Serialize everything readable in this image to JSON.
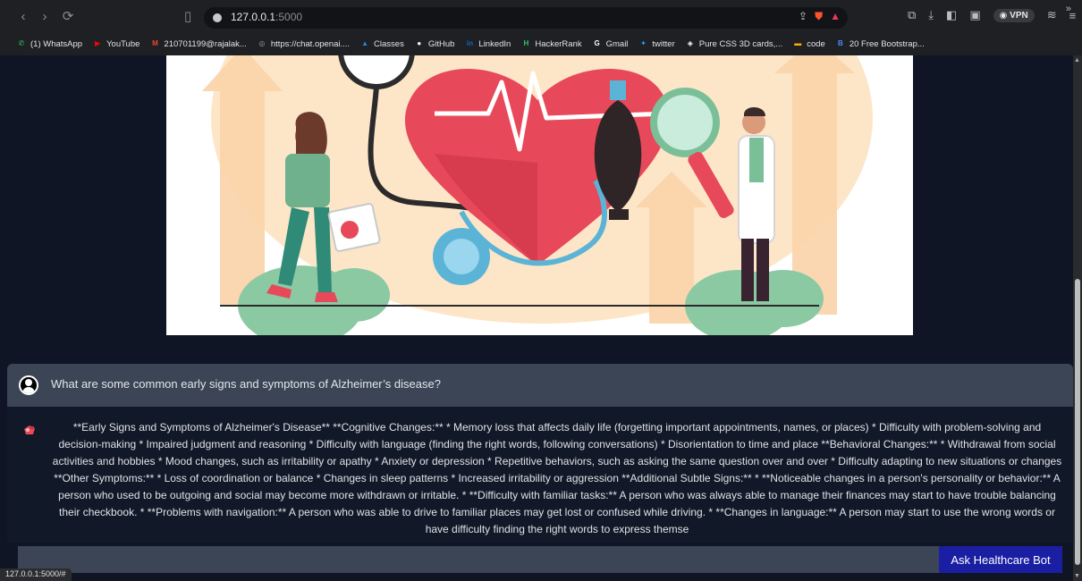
{
  "browser": {
    "url_host": "127.0.0.1",
    "url_port": ":5000",
    "vpn_label": "VPN",
    "bookmarks": [
      {
        "label": "(1) WhatsApp",
        "icon": "whatsapp-icon",
        "color": "#25d366"
      },
      {
        "label": "YouTube",
        "icon": "youtube-icon",
        "color": "#ff0000"
      },
      {
        "label": "210701199@rajalak...",
        "icon": "gmail-icon",
        "color": "#ea4335"
      },
      {
        "label": "https://chat.openai....",
        "icon": "openai-icon",
        "color": "#9a9a9a"
      },
      {
        "label": "Classes",
        "icon": "classroom-icon",
        "color": "#1e88e5"
      },
      {
        "label": "GitHub",
        "icon": "github-icon",
        "color": "#ffffff"
      },
      {
        "label": "LinkedIn",
        "icon": "linkedin-icon",
        "color": "#0a66c2"
      },
      {
        "label": "HackerRank",
        "icon": "hackerrank-icon",
        "color": "#2ec866"
      },
      {
        "label": "Gmail",
        "icon": "google-icon",
        "color": "#ffffff"
      },
      {
        "label": "twitter",
        "icon": "twitter-icon",
        "color": "#1da1f2"
      },
      {
        "label": "Pure CSS 3D cards,...",
        "icon": "codepen-icon",
        "color": "#ffffff"
      },
      {
        "label": "code",
        "icon": "folder-icon",
        "color": "#f4b400"
      },
      {
        "label": "20 Free Bootstrap...",
        "icon": "bootstrap-icon",
        "color": "#4a8cf7"
      }
    ],
    "bookmarks_more": "»",
    "status_url": "127.0.0.1:5000/#"
  },
  "chat": {
    "question": "What are some common early signs and symptoms of Alzheimer’s disease?",
    "answer": "**Early Signs and Symptoms of Alzheimer's Disease** **Cognitive Changes:** * Memory loss that affects daily life (forgetting important appointments, names, or places) * Difficulty with problem-solving and decision-making * Impaired judgment and reasoning * Difficulty with language (finding the right words, following conversations) * Disorientation to time and place **Behavioral Changes:** * Withdrawal from social activities and hobbies * Mood changes, such as irritability or apathy * Anxiety or depression * Repetitive behaviors, such as asking the same question over and over * Difficulty adapting to new situations or changes **Other Symptoms:** * Loss of coordination or balance * Changes in sleep patterns * Increased irritability or aggression **Additional Subtle Signs:** * **Noticeable changes in a person's personality or behavior:** A person who used to be outgoing and social may become more withdrawn or irritable. * **Difficulty with familiar tasks:** A person who was always able to manage their finances may start to have trouble balancing their checkbook. * **Problems with navigation:** A person who was able to drive to familiar places may get lost or confused while driving. * **Changes in language:** A person may start to use the wrong words or have difficulty finding the right words to express themse",
    "input_value": "",
    "ask_button": "Ask Healthcare Bot"
  },
  "colors": {
    "page_bg": "#0f1525",
    "card_bg": "#3b4556",
    "button_bg": "#1a1ea3"
  }
}
